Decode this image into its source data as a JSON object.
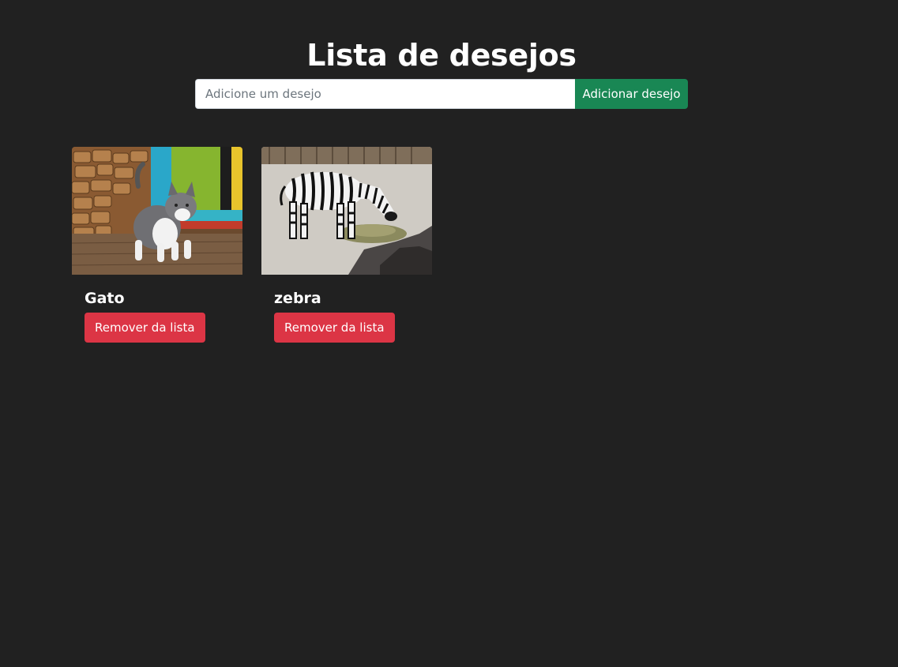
{
  "page": {
    "title": "Lista de desejos"
  },
  "form": {
    "input_value": "",
    "input_placeholder": "Adicione um desejo",
    "add_label": "Adicionar desejo"
  },
  "wishes": [
    {
      "name": "Gato",
      "image": "kitten-photo",
      "remove_label": "Remover da lista"
    },
    {
      "name": "zebra",
      "image": "zebra-photo",
      "remove_label": "Remover da lista"
    }
  ],
  "colors": {
    "background": "#212121",
    "add_button": "#198754",
    "remove_button": "#dc3545"
  }
}
